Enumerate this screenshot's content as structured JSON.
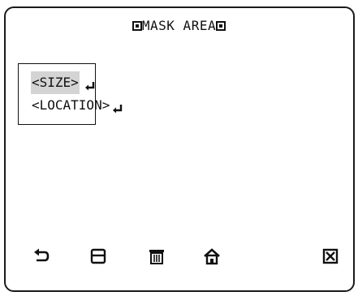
{
  "header": {
    "title": "MASK AREA",
    "left_marker_icon": "square-marker-icon",
    "right_marker_icon": "square-marker-icon"
  },
  "menu": {
    "items": [
      {
        "label": "<SIZE>",
        "icon": "enter-arrow-icon",
        "selected": true
      },
      {
        "label": "<LOCATION>",
        "icon": "enter-arrow-icon",
        "selected": false
      }
    ]
  },
  "toolbar": {
    "buttons": [
      {
        "name": "back",
        "icon": "return-arrow-icon"
      },
      {
        "name": "save",
        "icon": "save-icon"
      },
      {
        "name": "delete",
        "icon": "trash-icon"
      },
      {
        "name": "home",
        "icon": "home-icon"
      },
      {
        "name": "close",
        "icon": "close-box-icon"
      }
    ]
  },
  "colors": {
    "text": "#111111",
    "selection": "#d4d4d4",
    "background": "#ffffff"
  }
}
